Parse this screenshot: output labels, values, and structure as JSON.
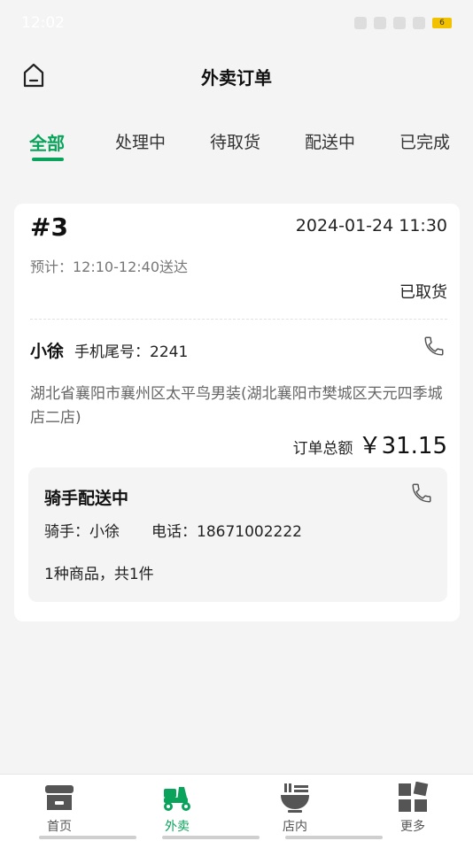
{
  "status_bar": {
    "time": "12:02",
    "battery_level": "6"
  },
  "header": {
    "title": "外卖订单"
  },
  "tabs": [
    {
      "label": "全部",
      "active": true
    },
    {
      "label": "处理中",
      "active": false
    },
    {
      "label": "待取货",
      "active": false
    },
    {
      "label": "配送中",
      "active": false
    },
    {
      "label": "已完成",
      "active": false
    }
  ],
  "order": {
    "number": "#3",
    "datetime": "2024-01-24 11:30",
    "eta": "预计：12:10-12:40送达",
    "status": "已取货",
    "customer_name": "小徐",
    "phone_tail": "手机尾号：2241",
    "address": "湖北省襄阳市襄州区太平鸟男装(湖北襄阳市樊城区天元四季城店二店)",
    "total_label": "订单总额",
    "total_amount": "￥31.15",
    "rider": {
      "title": "骑手配送中",
      "name": "骑手：小徐",
      "phone": "电话：18671002222"
    },
    "goods_summary": "1种商品，共1件"
  },
  "bottom_nav": [
    {
      "label": "首页",
      "icon": "store-icon",
      "active": false
    },
    {
      "label": "外卖",
      "icon": "scooter-icon",
      "active": true
    },
    {
      "label": "店内",
      "icon": "bowl-icon",
      "active": false
    },
    {
      "label": "更多",
      "icon": "grid-icon",
      "active": false
    }
  ],
  "colors": {
    "accent": "#0aa35b",
    "background": "#f4f4f4",
    "card": "#ffffff",
    "nav_icon": "#555555"
  }
}
